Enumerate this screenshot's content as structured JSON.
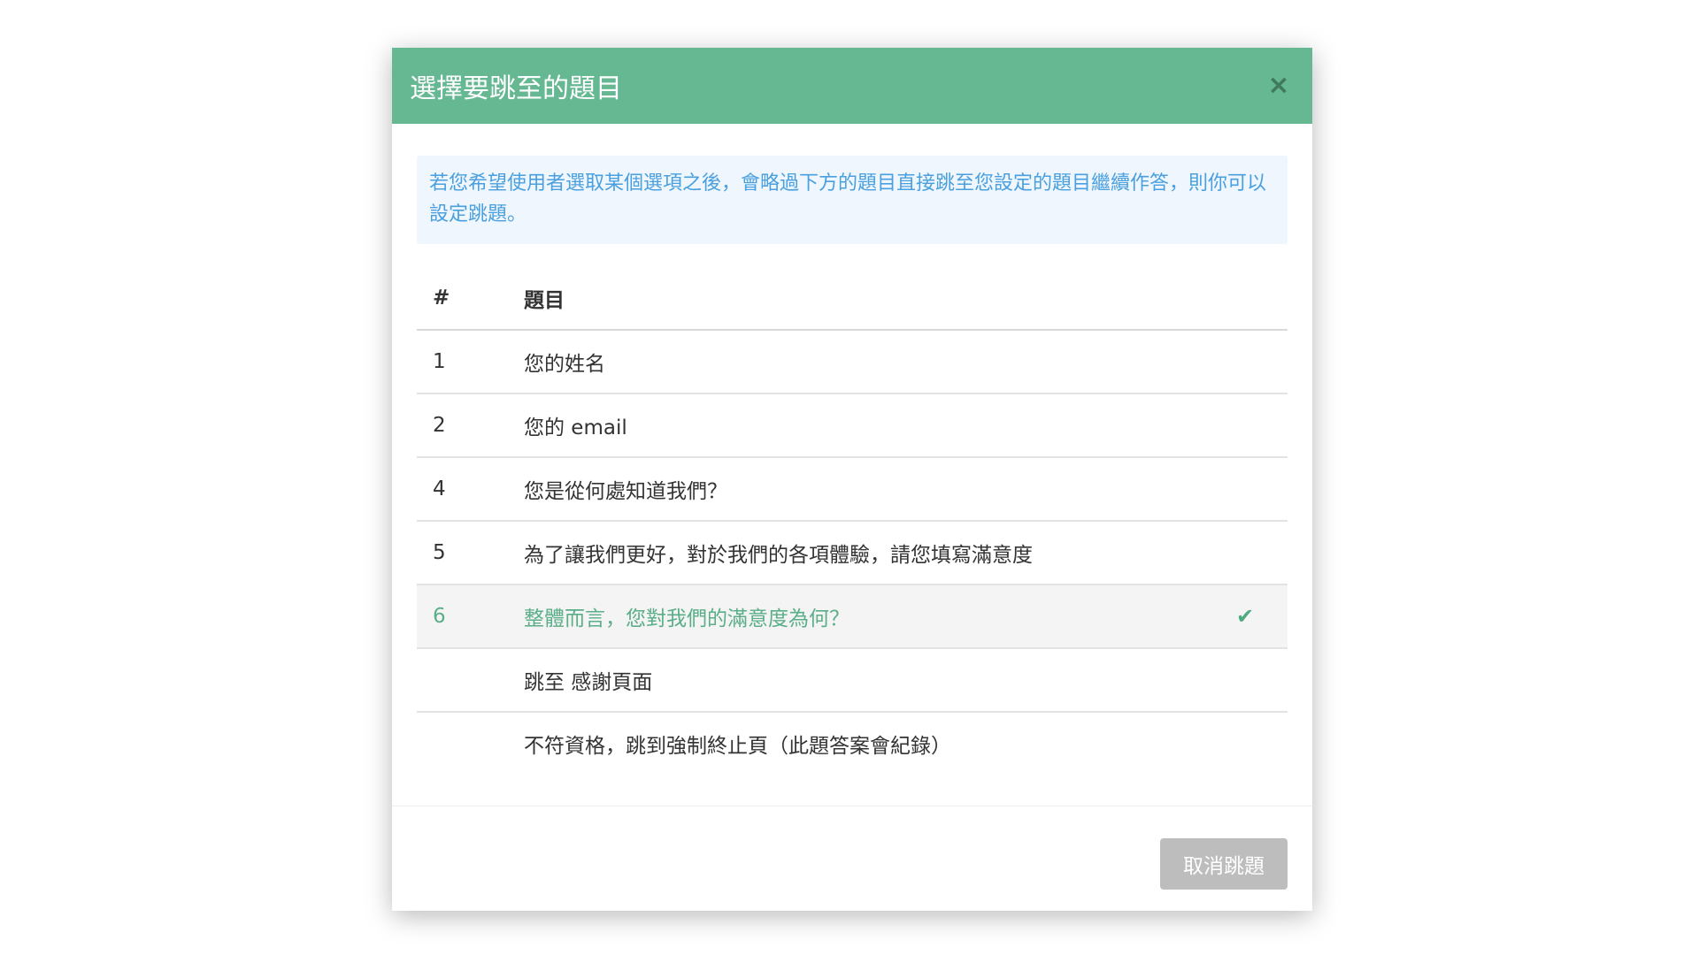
{
  "modal": {
    "title": "選擇要跳至的題目",
    "close_label": "×",
    "info_text": "若您希望使用者選取某個選項之後，會略過下方的題目直接跳至您設定的題目繼續作答，則你可以設定跳題。",
    "table": {
      "header_num": "#",
      "header_question": "題目",
      "rows": [
        {
          "num": "1",
          "question": "您的姓名"
        },
        {
          "num": "2",
          "question": "您的 email"
        },
        {
          "num": "4",
          "question": "您是從何處知道我們？"
        },
        {
          "num": "5",
          "question": "為了讓我們更好，對於我們的各項體驗，請您填寫滿意度"
        },
        {
          "num": "6",
          "question": "整體而言，您對我們的滿意度為何？",
          "selected": true,
          "check": "✔"
        },
        {
          "num": "",
          "question": "跳至 感謝頁面"
        },
        {
          "num": "",
          "question": "不符資格，跳到強制終止頁（此題答案會紀錄）"
        }
      ]
    },
    "cancel_label": "取消跳題"
  },
  "colors": {
    "header_bg": "#66b893",
    "info_text": "#4aa0df",
    "info_bg": "#eff6fd",
    "selected_text": "#5aae88",
    "cancel_bg": "#bdbdbd"
  },
  "icons": {
    "close": "close-icon",
    "check": "check-icon"
  }
}
